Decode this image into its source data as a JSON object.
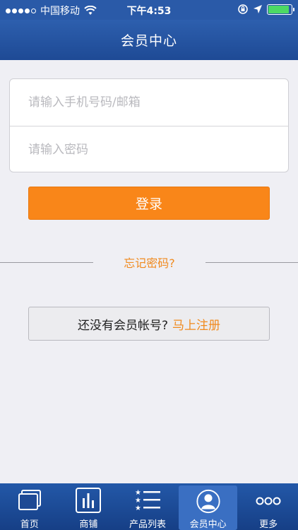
{
  "status_bar": {
    "carrier": "中国移动",
    "time": "下午4:53",
    "battery_level": 0.9
  },
  "nav": {
    "title": "会员中心"
  },
  "form": {
    "account_placeholder": "请输入手机号码/邮箱",
    "password_placeholder": "请输入密码"
  },
  "login_label": "登录",
  "forgot_label": "忘记密码?",
  "register": {
    "question": "还没有会员帐号?",
    "link": "马上注册"
  },
  "tabbar": {
    "active": "会员中心",
    "items": [
      {
        "label": "首页",
        "icon": "home-icon"
      },
      {
        "label": "商铺",
        "icon": "shop-icon"
      },
      {
        "label": "产品列表",
        "icon": "product-list-icon"
      },
      {
        "label": "会员中心",
        "icon": "member-icon"
      },
      {
        "label": "更多",
        "icon": "more-icon"
      }
    ]
  },
  "colors": {
    "nav_blue": "#2a5aa8",
    "accent_orange": "#f98619",
    "background": "#efeff4"
  }
}
